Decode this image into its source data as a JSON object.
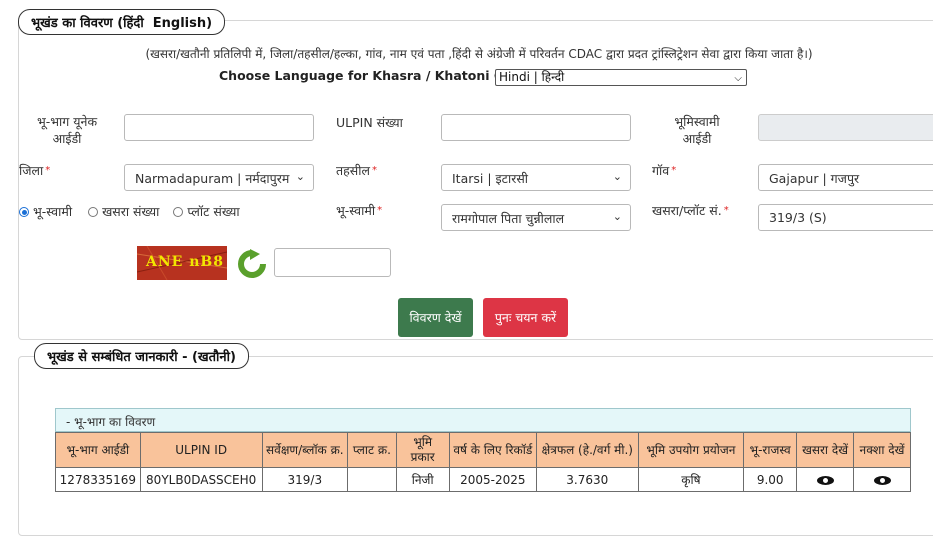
{
  "section1": {
    "legend_prefix": "भूखंड का विवरण",
    "legend_hindi": "(हिंदी",
    "legend_english": "English)",
    "note": "(खसरा/खतौनी प्रतिलिपी में, जिला/तहसील/हल्का, गांव, नाम एवं पता ,हिंदी से अंग्रेजी में परिवर्तन CDAC द्वारा प्रदत ट्रांस्लिट्रेशन सेवा द्वारा किया जाता है।)",
    "language_label": "Choose Language for Khasra / Khatoni Copy:",
    "language_value": "Hindi | हिन्दी"
  },
  "form": {
    "unique_id_label": "भू-भाग  यूनेक आईडी",
    "unique_id_value": "",
    "ulpin_label": "ULPIN संख्या",
    "ulpin_value": "",
    "owner_id_label": "भूमिस्वामी आईडी",
    "owner_id_value": "",
    "district_label": "जिला",
    "district_value": "Narmadapuram | नर्मदापुरम",
    "tehsil_label": "तहसील",
    "tehsil_value": "Itarsi | इटारसी",
    "village_label": "गॉव",
    "village_value": "Gajapur | गजपुर",
    "radio_owner": "भू-स्वामी",
    "radio_khasra": "खसरा संख्या",
    "radio_plot": "प्लॉट संख्या",
    "owner_label": "भू-स्वामी",
    "owner_value": "रामगोपाल पिता चुन्नीलाल",
    "khasra_label": "खसरा/प्लॉट सं.",
    "khasra_value": "319/3 (S)",
    "required_mark": "*",
    "captcha_text": "ANE nB8",
    "captcha_input": "",
    "view_button": "विवरण देखें",
    "reset_button": "पुनः चयन करें"
  },
  "section2": {
    "legend": "भूखंड से सम्बंधित जानकारी -   (खतौनी)",
    "table_title": "- भू-भाग का विवरण",
    "headers": [
      "भू-भाग आईडी",
      "ULPIN ID",
      "सर्वेक्षण/ब्लॉक क्र.",
      "प्लाट क्र.",
      "भूमि प्रकार",
      "वर्ष के लिए रिकॉर्ड",
      "क्षेत्रफल (हे./वर्ग मी.)",
      "भूमि उपयोग प्रयोजन",
      "भू-राजस्व",
      "खसरा देखें",
      "नक्शा देखें"
    ],
    "row": [
      "1278335169",
      "80YLB0DASSCEH0",
      "319/3",
      "",
      "निजी",
      "2005-2025",
      "3.7630",
      "कृषि",
      "9.00"
    ]
  },
  "colors": {
    "view_button": "#3d7a4d",
    "reset_button": "#dd3545",
    "table_header": "#f9c39b",
    "table_title_bg": "#e4f7f9",
    "radio_accent": "#1a6fd6"
  },
  "icons": [
    "refresh-icon",
    "eye-icon",
    "chevron-down-icon"
  ]
}
